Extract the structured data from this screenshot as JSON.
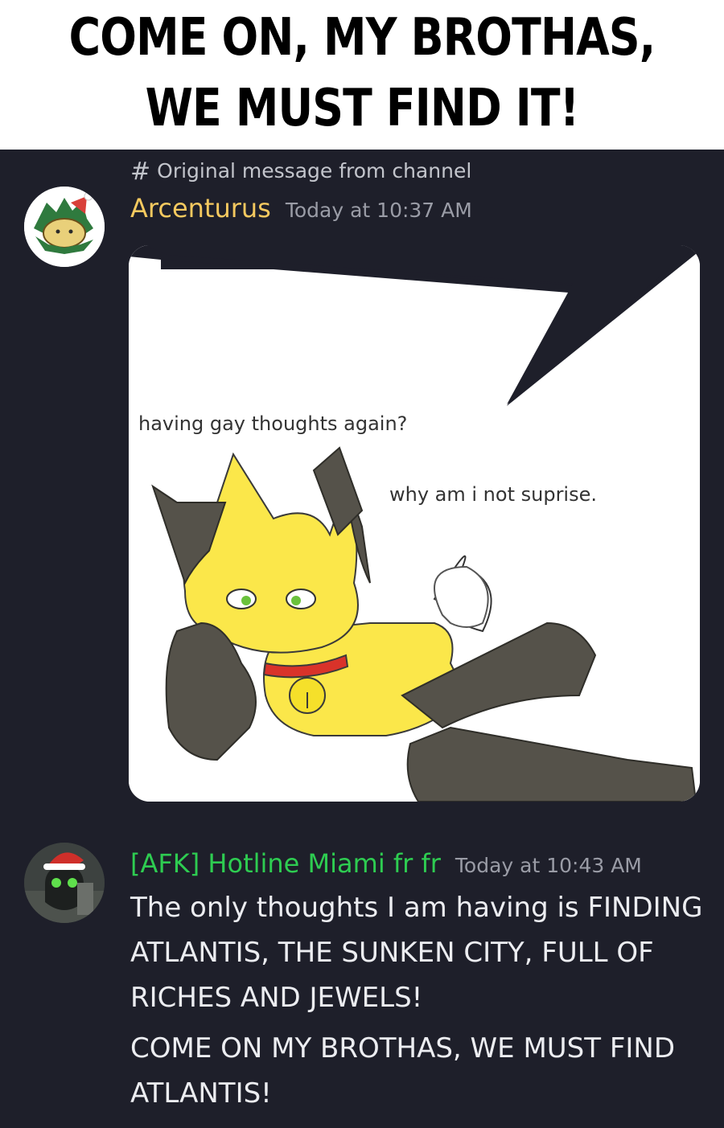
{
  "meme_caption": {
    "line1": "COME ON, MY BROTHAS,",
    "line2": "WE MUST FIND IT!"
  },
  "reference": {
    "icon": "hash-icon",
    "text": "Original message from channel"
  },
  "messages": [
    {
      "username": "Arcenturus",
      "timestamp": "Today at 10:37 AM",
      "username_color": "#f5c95f",
      "attachment": {
        "text_left": "having gay thoughts again?",
        "text_right": "why am i not suprise."
      }
    },
    {
      "username": "[AFK] Hotline Miami fr fr",
      "timestamp": "Today at 10:43 AM",
      "username_color": "#2ecc51",
      "paragraphs": [
        "The only thoughts I am having is FINDING ATLANTIS, THE SUNKEN CITY, FULL OF RICHES AND JEWELS!",
        "COME ON MY BROTHAS, WE MUST FIND ATLANTIS!"
      ]
    }
  ],
  "colors": {
    "background": "#1e1f2a",
    "text": "#ecedf1",
    "muted": "#9a9ca6"
  }
}
